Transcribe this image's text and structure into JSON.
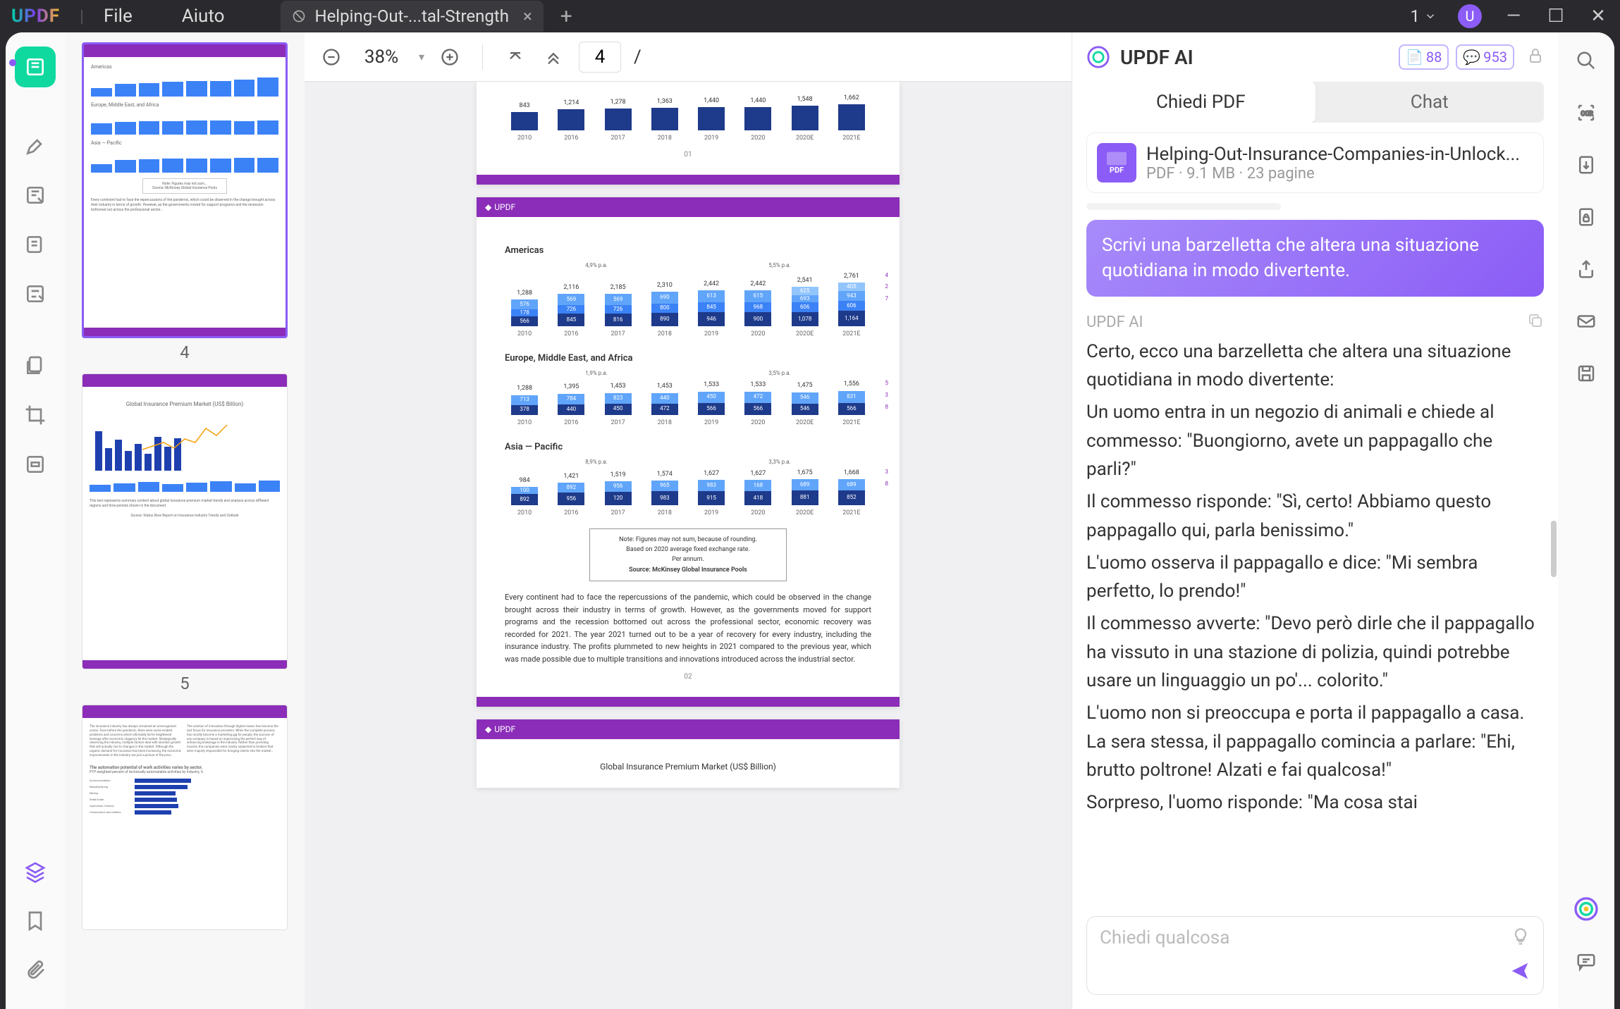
{
  "titlebar": {
    "logo": "UPDF",
    "menu": {
      "file": "File",
      "help": "Aiuto"
    },
    "tab": {
      "title": "Helping-Out-...tal-Strength"
    },
    "win_badge": "1",
    "user_initial": "U"
  },
  "toolbar": {
    "zoom": "38%",
    "page_current": "4",
    "page_sep": "/"
  },
  "thumbnails": {
    "page4_num": "4",
    "page5_num": "5"
  },
  "doc": {
    "brand": "UPDF",
    "page4": {
      "years": [
        "2010",
        "2016",
        "2017",
        "2018",
        "2019",
        "2020",
        "2020E",
        "2021E"
      ],
      "top_totals": [
        "843",
        "1,214",
        "1,278",
        "1,363",
        "1,440",
        "1,440",
        "1,548",
        "1,662"
      ],
      "americas_title": "Americas",
      "americas_growth_left": "4,9% p.a.",
      "americas_growth_right": "5,5% p.a.",
      "americas_totals": [
        "1,288",
        "2,116",
        "2,185",
        "2,310",
        "2,442",
        "2,442",
        "2,541",
        "2,761"
      ],
      "americas_seg_top": [
        "576",
        "569",
        "569",
        "690",
        "613",
        "615",
        "625",
        "405",
        "693",
        "943"
      ],
      "americas_seg_mid": [
        "178",
        "845",
        "816",
        "726",
        "800",
        "946",
        "845",
        "968",
        "900",
        "606",
        "1,078",
        "1,164"
      ],
      "americas_seg_bot": [
        "566"
      ],
      "eu_title": "Europe, Middle East, and Africa",
      "eu_growth_left": "1,9% p.a.",
      "eu_growth_right": "3,5% p.a.",
      "eu_totals": [
        "1,288",
        "1,395",
        "1,453",
        "1,453",
        "1,533",
        "1,533",
        "1,475",
        "1,556"
      ],
      "eu_seg_top": [
        "713",
        "784",
        "378",
        "823",
        "440",
        "450",
        "472",
        "566",
        "546",
        "831"
      ],
      "ap_title": "Asia — Pacific",
      "ap_growth_left": "8,9% p.a.",
      "ap_growth_right": "3,3% p.a.",
      "ap_totals": [
        "984",
        "1,421",
        "1,519",
        "1,574",
        "1,627",
        "1,627",
        "1,675",
        "1,668"
      ],
      "ap_seg": [
        "100",
        "892",
        "956",
        "120",
        "965",
        "983",
        "168",
        "915",
        "418",
        "689",
        "881",
        "852"
      ],
      "note1": "Note: Figures may not sum, because of rounding.",
      "note2": "Based on 2020 average fixed exchange rate.",
      "note3": "Per annum.",
      "note_src": "Source: McKinsey Global Insurance Pools",
      "para": "Every continent had to face the repercussions of the pandemic, which could be observed in the change brought across their industry in terms of growth. However, as the governments moved for support programs and the recession bottomed out across the professional sector, economic recovery was recorded for 2021. The year 2021 turned out to be a year of recovery for every industry, including the insurance industry. The profits plummeted to new heights in 2021 compared to the previous year, which was made possible due to multiple transitions and innovations introduced across the industrial sector.",
      "pgnum1": "01",
      "pgnum2": "02"
    },
    "page5_title": "Global Insurance Premium Market (US$ Billion)"
  },
  "ai": {
    "title": "UPDF AI",
    "badge1": "88",
    "badge2": "953",
    "tab_ask": "Chiedi PDF",
    "tab_chat": "Chat",
    "file_name": "Helping-Out-Insurance-Companies-in-Unlock...",
    "file_meta": "PDF · 9.1 MB · 23 pagine",
    "prompt": "Scrivi una barzelletta che altera una situazione quotidiana in modo divertente.",
    "from": "UPDF AI",
    "r1": "Certo, ecco una barzelletta che altera una situazione quotidiana in modo divertente:",
    "r2": "Un uomo entra in un negozio di animali e chiede al commesso: \"Buongiorno, avete un pappagallo che parli?\"",
    "r3": "Il commesso risponde: \"Sì, certo! Abbiamo questo pappagallo qui, parla benissimo.\"",
    "r4": "L'uomo osserva il pappagallo e dice: \"Mi sembra perfetto, lo prendo!\"",
    "r5": "Il commesso avverte: \"Devo però dirle che il pappagallo ha vissuto in una stazione di polizia, quindi potrebbe usare un linguaggio un po'... colorito.\"",
    "r6": "L'uomo non si preoccupa e porta il pappagallo a casa. La sera stessa, il pappagallo comincia a parlare: \"Ehi, brutto poltrone! Alzati e fai qualcosa!\"",
    "r7": "Sorpreso, l'uomo risponde: \"Ma cosa stai",
    "input_placeholder": "Chiedi qualcosa"
  },
  "chart_data": [
    {
      "type": "bar",
      "title": "Americas",
      "categories": [
        "2010",
        "2016",
        "2017",
        "2018",
        "2019",
        "2020",
        "2020E",
        "2021E"
      ],
      "values": [
        1288,
        2116,
        2185,
        2310,
        2442,
        2442,
        2541,
        2761
      ],
      "growth_labels": [
        "4,9% p.a.",
        "5,5% p.a."
      ]
    },
    {
      "type": "bar",
      "title": "Europe, Middle East, and Africa",
      "categories": [
        "2010",
        "2016",
        "2017",
        "2018",
        "2019",
        "2020",
        "2020E",
        "2021E"
      ],
      "values": [
        1288,
        1395,
        1453,
        1453,
        1533,
        1533,
        1475,
        1556
      ],
      "growth_labels": [
        "1,9% p.a.",
        "3,5% p.a."
      ]
    },
    {
      "type": "bar",
      "title": "Asia — Pacific",
      "categories": [
        "2010",
        "2016",
        "2017",
        "2018",
        "2019",
        "2020",
        "2020E",
        "2021E"
      ],
      "values": [
        984,
        1421,
        1519,
        1574,
        1627,
        1627,
        1675,
        1668
      ],
      "growth_labels": [
        "8,9% p.a.",
        "3,3% p.a."
      ]
    }
  ]
}
